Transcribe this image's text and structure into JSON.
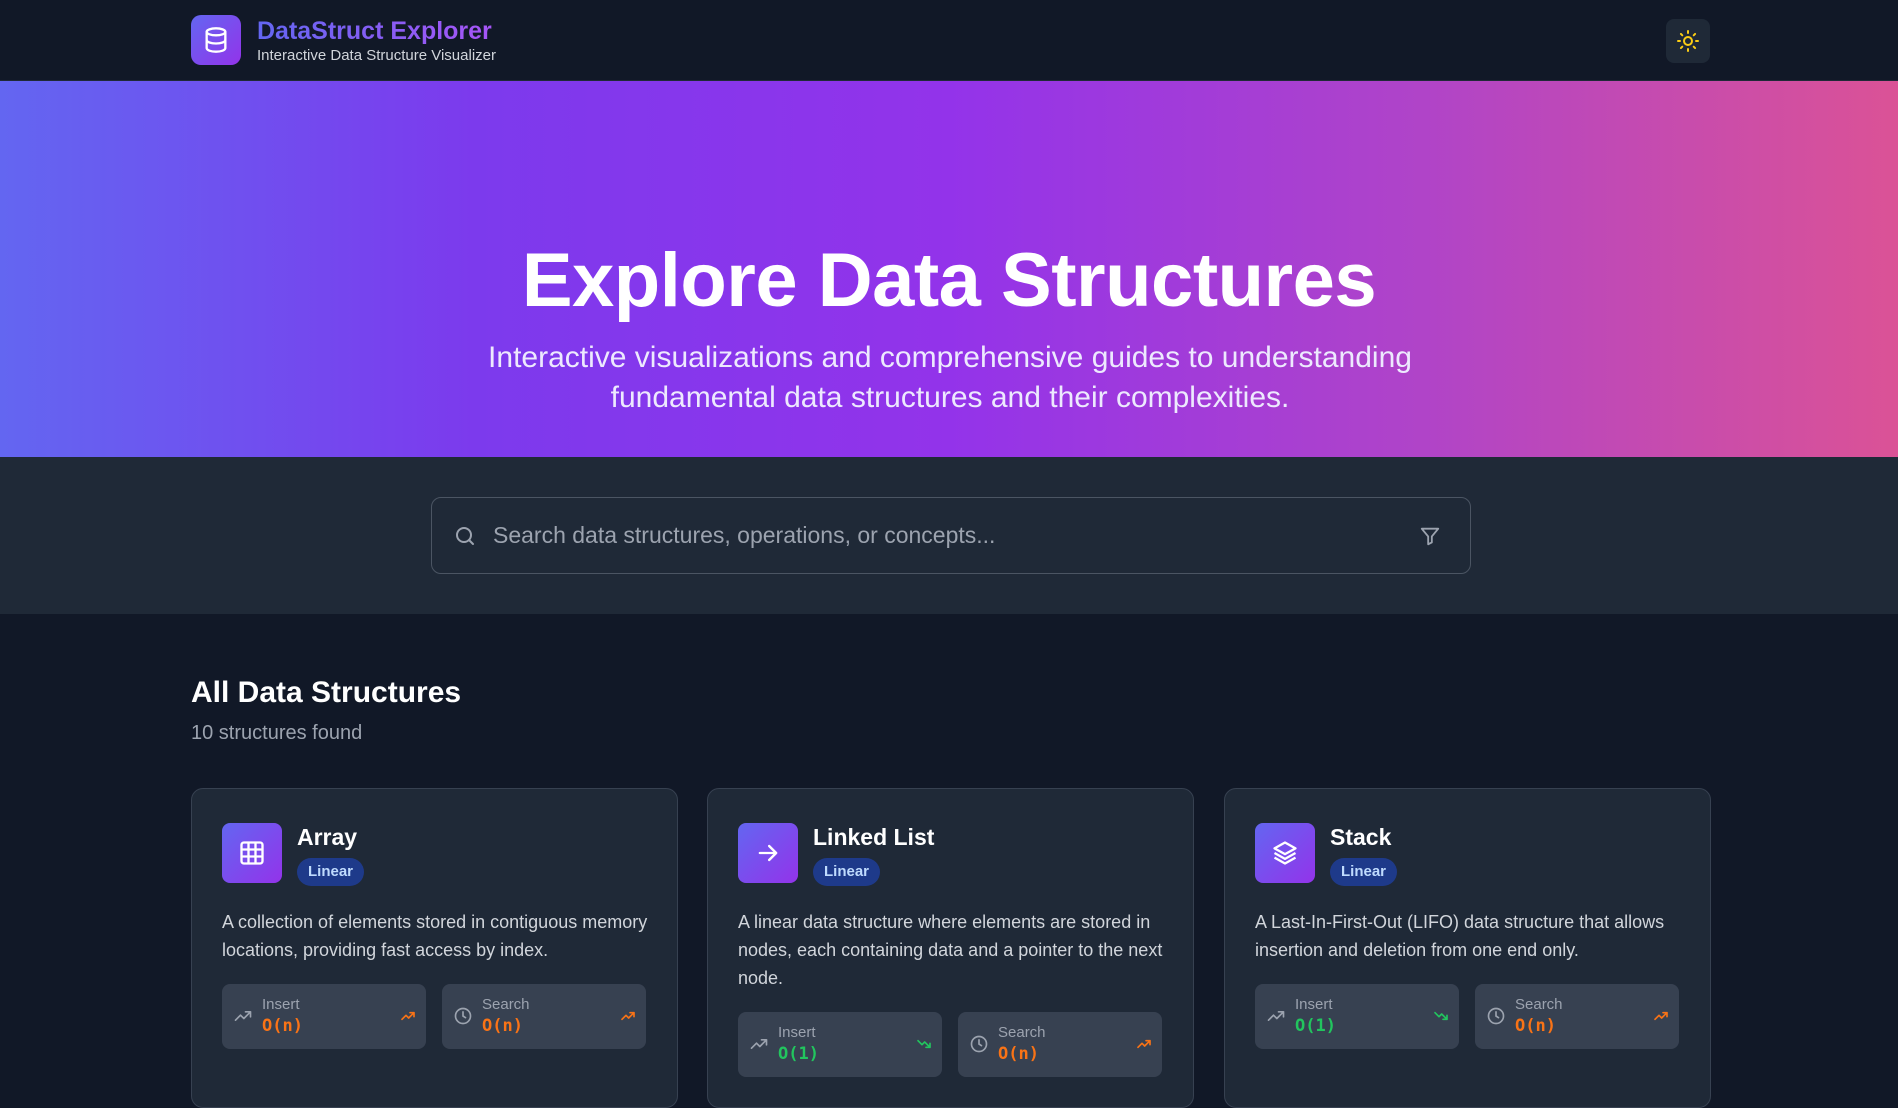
{
  "header": {
    "app_title": "DataStruct Explorer",
    "app_subtitle": "Interactive Data Structure Visualizer",
    "logo_icon": "database-icon",
    "theme_toggle_icon": "sun-icon"
  },
  "hero": {
    "title": "Explore Data Structures",
    "description": "Interactive visualizations and comprehensive guides to understanding fundamental data structures and their complexities."
  },
  "search": {
    "placeholder": "Search data structures, operations, or concepts...",
    "value": "",
    "filter_icon": "filter-icon"
  },
  "section": {
    "title": "All Data Structures",
    "count_text": "10 structures found"
  },
  "cards": [
    {
      "name": "Array",
      "icon": "grid-icon",
      "category": "Linear",
      "description": "A collection of elements stored in contiguous memory locations, providing fast access by index.",
      "ops": [
        {
          "label": "Insert",
          "value": "O(n)",
          "trend": "up",
          "color": "#f97316"
        },
        {
          "label": "Search",
          "value": "O(n)",
          "trend": "up",
          "color": "#f97316"
        }
      ]
    },
    {
      "name": "Linked List",
      "icon": "arrow-right-icon",
      "category": "Linear",
      "description": "A linear data structure where elements are stored in nodes, each containing data and a pointer to the next node.",
      "ops": [
        {
          "label": "Insert",
          "value": "O(1)",
          "trend": "down",
          "color": "#22c55e"
        },
        {
          "label": "Search",
          "value": "O(n)",
          "trend": "up",
          "color": "#f97316"
        }
      ]
    },
    {
      "name": "Stack",
      "icon": "layers-icon",
      "category": "Linear",
      "description": "A Last-In-First-Out (LIFO) data structure that allows insertion and deletion from one end only.",
      "ops": [
        {
          "label": "Insert",
          "value": "O(1)",
          "trend": "down",
          "color": "#22c55e"
        },
        {
          "label": "Search",
          "value": "O(n)",
          "trend": "up",
          "color": "#f97316"
        }
      ]
    }
  ]
}
